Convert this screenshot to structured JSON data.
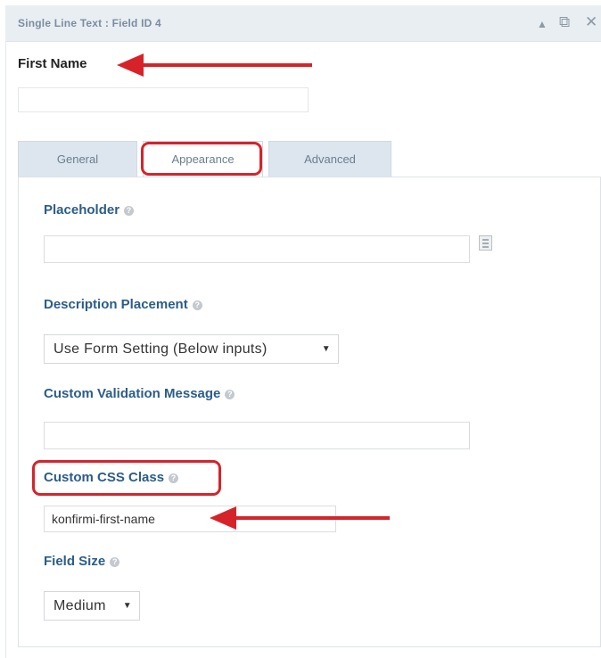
{
  "header": {
    "title": "Single Line Text : Field ID 4"
  },
  "field": {
    "label": "First Name"
  },
  "tabs": [
    {
      "label": "General"
    },
    {
      "label": "Appearance"
    },
    {
      "label": "Advanced"
    }
  ],
  "settings": {
    "placeholder_label": "Placeholder",
    "description_placement_label": "Description Placement",
    "description_placement_value": "Use Form Setting (Below inputs)",
    "custom_validation_label": "Custom Validation Message",
    "custom_css_label": "Custom CSS Class",
    "custom_css_value": "konfirmi-first-name",
    "field_size_label": "Field Size",
    "field_size_value": "Medium"
  },
  "icons": {
    "collapse": "collapse-icon",
    "duplicate": "duplicate-icon",
    "delete": "close-icon",
    "help": "question-icon",
    "merge_tags": "merge-tag-icon"
  },
  "annotation_color": "#d6232a"
}
